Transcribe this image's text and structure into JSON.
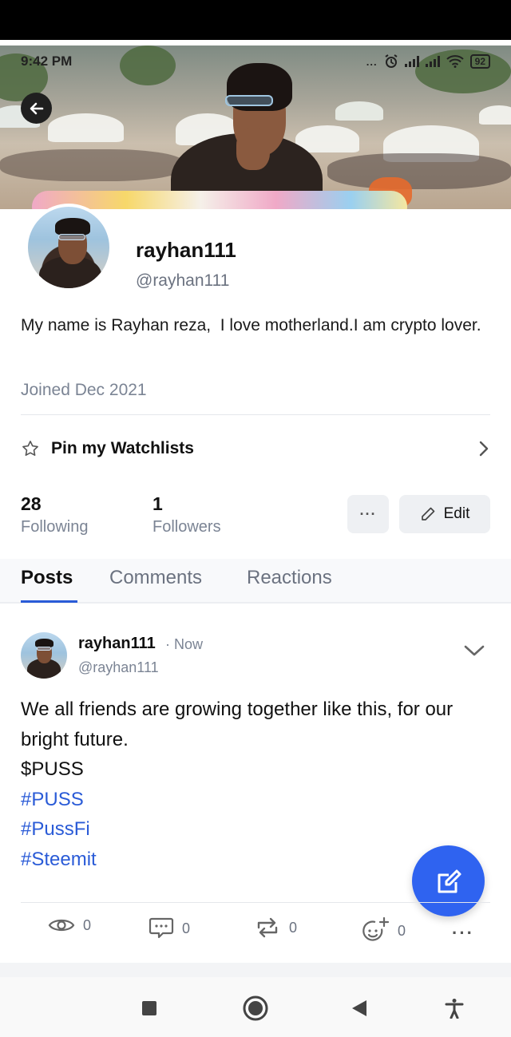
{
  "status_bar": {
    "time": "9:42 PM",
    "overflow": "...",
    "battery": "92"
  },
  "profile": {
    "display_name": "rayhan111",
    "handle": "@rayhan111",
    "bio": "My name is Rayhan reza,  I love motherland.I am crypto lover.",
    "joined": "Joined Dec 2021",
    "pin_label": "Pin my Watchlists",
    "following_count": "28",
    "following_label": "Following",
    "followers_count": "1",
    "followers_label": "Followers",
    "more_label": "···",
    "edit_label": "Edit"
  },
  "tabs": [
    {
      "label": "Posts",
      "active": true
    },
    {
      "label": "Comments",
      "active": false
    },
    {
      "label": "Reactions",
      "active": false
    }
  ],
  "post": {
    "author": "rayhan111",
    "time": "· Now",
    "handle": "@rayhan111",
    "text_line1": "We all friends are growing together like this, for our bright future.",
    "ticker": "$PUSS",
    "hashtags": [
      "#PUSS",
      "#PussFi",
      "#Steemit"
    ],
    "views": "0",
    "comments": "0",
    "reposts": "0",
    "reactions": "0",
    "more": "···"
  },
  "colors": {
    "accent": "#2a5bd7",
    "fab": "#2f63f0",
    "muted": "#7b8494"
  },
  "icons": {
    "back": "arrow-left-icon",
    "pin": "star-icon",
    "chevron": "chevron-right-icon",
    "edit": "pencil-icon",
    "post_menu": "chevron-down-icon",
    "views": "eye-icon",
    "comments": "comment-icon",
    "reposts": "repost-icon",
    "reactions": "add-reaction-icon",
    "compose": "compose-icon"
  }
}
